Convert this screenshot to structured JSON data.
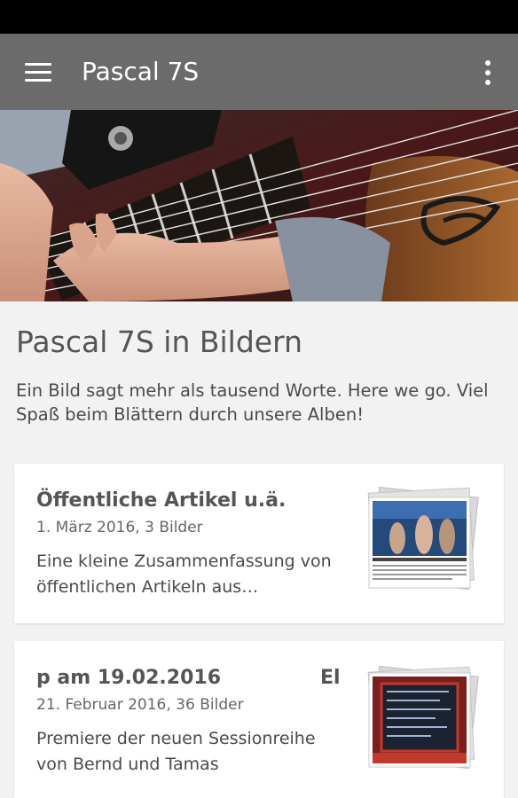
{
  "app": {
    "title": "Pascal 7S"
  },
  "page": {
    "title": "Pascal 7S in Bildern",
    "intro": "Ein Bild sagt mehr als tausend Worte. Here we go. Viel Spaß beim Blättern durch unsere Alben!"
  },
  "albums": [
    {
      "title": "Öffentliche Artikel u.ä.",
      "meta": "1. März 2016, 3 Bilder",
      "description": "Eine kleine Zusammenfassung von öffentlichen Artikeln aus…"
    },
    {
      "title": "p am 19.02.2016",
      "title_tail": "El",
      "meta": "21. Februar 2016, 36 Bilder",
      "description": "Premiere der neuen Sessionreihe von Bernd und Tamas"
    }
  ],
  "icons": {
    "menu": "hamburger-menu-icon",
    "overflow": "more-vert-icon"
  },
  "colors": {
    "appbar": "#6b6b6b",
    "statusbar": "#000000",
    "background": "#f2f2f2"
  }
}
